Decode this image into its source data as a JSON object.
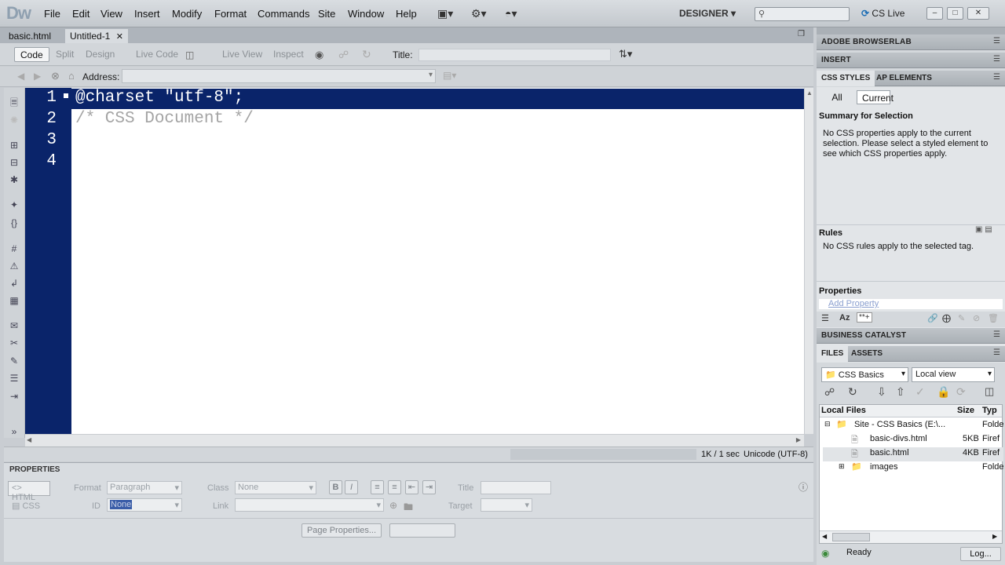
{
  "app": {
    "logo": "Dw"
  },
  "menubar": {
    "items": [
      "File",
      "Edit",
      "View",
      "Insert",
      "Modify",
      "Format",
      "Commands",
      "Site",
      "Window",
      "Help"
    ],
    "workspace": "DESIGNER",
    "cslive": "CS Live"
  },
  "doc_tabs": [
    {
      "label": "basic.html"
    },
    {
      "label": "Untitled-1"
    }
  ],
  "doc_toolbar": {
    "views": [
      "Code",
      "Split",
      "Design",
      "Live Code",
      "Live View",
      "Inspect"
    ],
    "active_view": "Code",
    "title_label": "Title:",
    "title_value": ""
  },
  "address_bar": {
    "label": "Address:",
    "value": ""
  },
  "editor": {
    "lines": [
      {
        "num": "1",
        "text": "@charset \"utf-8\";"
      },
      {
        "num": "2",
        "text": "/* CSS Document */"
      },
      {
        "num": "3",
        "text": ""
      },
      {
        "num": "4",
        "text": ""
      }
    ]
  },
  "statusbar": {
    "size": "1K / 1 sec",
    "encoding": "Unicode (UTF-8)"
  },
  "properties": {
    "header": "PROPERTIES",
    "html_tab": "HTML",
    "css_tab": "CSS",
    "format_label": "Format",
    "format_value": "Paragraph",
    "class_label": "Class",
    "class_value": "None",
    "id_label": "ID",
    "id_value": "None",
    "link_label": "Link",
    "title_label": "Title",
    "target_label": "Target",
    "page_props_button": "Page Properties..."
  },
  "right_panels": {
    "browserlab": "ADOBE BROWSERLAB",
    "insert": "INSERT",
    "css_styles_tab": "CSS STYLES",
    "ap_elements_tab": "AP ELEMENTS",
    "all_label": "All",
    "current_label": "Current",
    "summary_title": "Summary for Selection",
    "summary_text": "No CSS properties apply to the current selection.  Please select a styled element to see which CSS properties apply.",
    "rules_title": "Rules",
    "rules_text": "No CSS rules apply to the selected tag.",
    "properties_title": "Properties",
    "add_property": "Add Property",
    "business_catalyst": "BUSINESS CATALYST",
    "files_tab": "FILES",
    "assets_tab": "ASSETS",
    "site_select": "CSS Basics",
    "view_select": "Local view",
    "files_columns": [
      "Local Files",
      "Size",
      "Typ"
    ],
    "files": [
      {
        "name": "Site - CSS Basics (E:\\...",
        "size": "",
        "type": "Folde"
      },
      {
        "name": "basic-divs.html",
        "size": "5KB",
        "type": "Firef"
      },
      {
        "name": "basic.html",
        "size": "4KB",
        "type": "Firef"
      },
      {
        "name": "images",
        "size": "",
        "type": "Folde"
      }
    ],
    "status": "Ready",
    "log_button": "Log..."
  }
}
